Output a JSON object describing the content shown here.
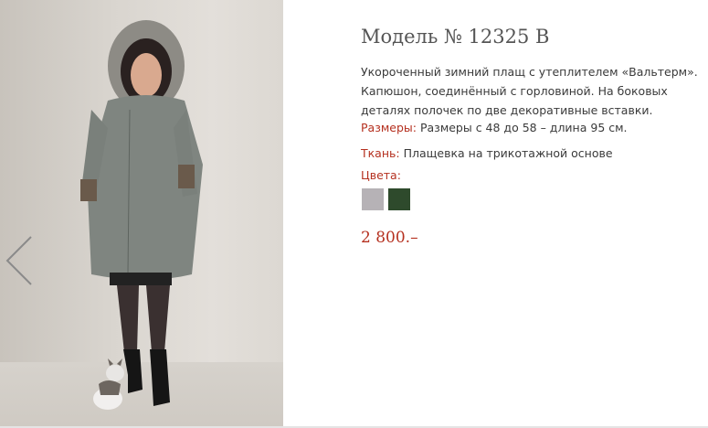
{
  "product": {
    "title": "Модель № 12325 В",
    "description": "Укороченный зимний плащ с утеплителем «Вальтерм». Капюшон, соединённый  с горловиной. На боковых деталях полочек по две декоративные вставки.",
    "sizes_label": "Размеры:",
    "sizes_value": "Размеры с 48 до 58 – длина 95 см.",
    "fabric_label": "Ткань:",
    "fabric_value": "Плащевка на трикотажной основе",
    "colors_label": "Цвета:",
    "colors": [
      {
        "name": "grey",
        "hex": "#b6b2b6"
      },
      {
        "name": "dark-green",
        "hex": "#2e4a2c"
      }
    ],
    "price": "2 800.–"
  },
  "gallery": {
    "prev_icon": "chevron-left-icon"
  }
}
